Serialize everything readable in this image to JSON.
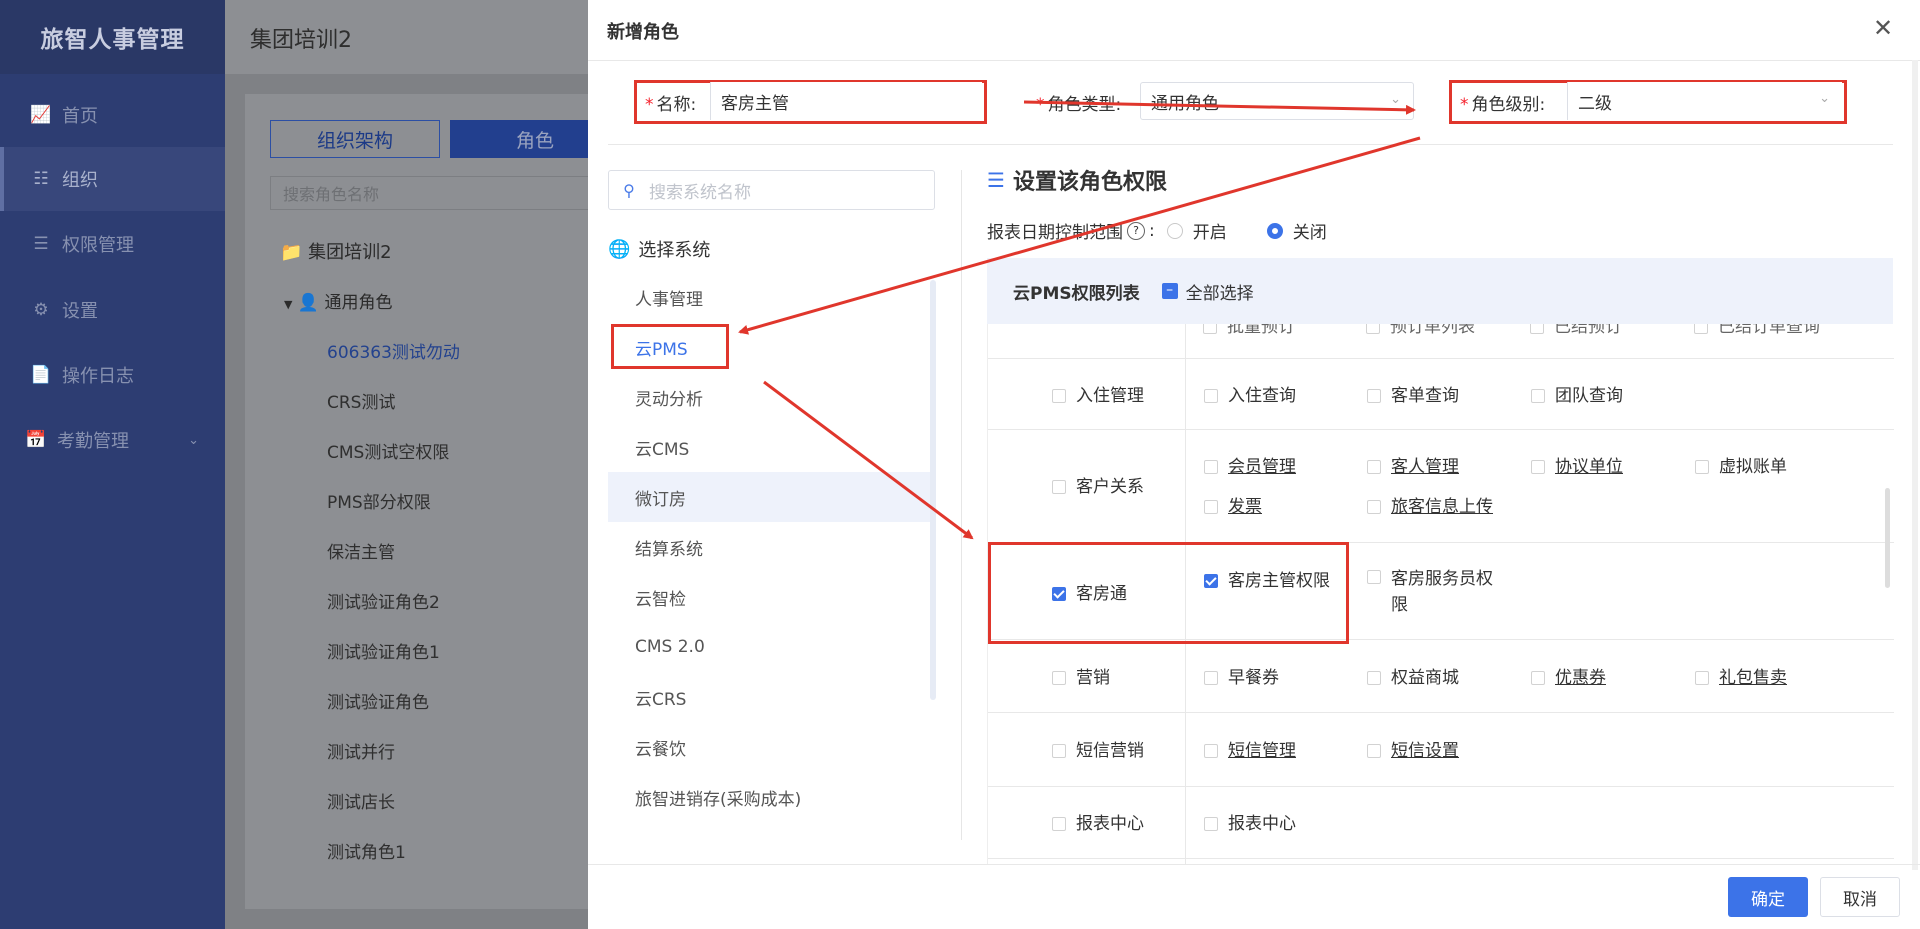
{
  "app": {
    "brand": "旅智人事管理",
    "nav": [
      {
        "label": "首页",
        "icon": "chart-icon"
      },
      {
        "label": "组织",
        "icon": "org-icon",
        "active": true
      },
      {
        "label": "权限管理",
        "icon": "sliders-icon"
      },
      {
        "label": "设置",
        "icon": "gear-icon"
      },
      {
        "label": "操作日志",
        "icon": "document-icon"
      },
      {
        "label": "考勤管理",
        "icon": "calendar-icon"
      }
    ]
  },
  "background": {
    "page_title": "集团培训2",
    "tabs": [
      "组织架构",
      "角色"
    ],
    "search_placeholder": "搜索角色名称",
    "tree_root": "集团培训2",
    "tree_group": "通用角色",
    "roles": [
      "606363测试勿动",
      "CRS测试",
      "CMS测试空权限",
      "PMS部分权限",
      "保洁主管",
      "测试验证角色2",
      "测试验证角色1",
      "测试验证角色",
      "测试并行",
      "测试店长",
      "测试角色1"
    ]
  },
  "modal": {
    "title": "新增角色",
    "name_label": "名称:",
    "name_value": "客房主管",
    "type_label": "角色类型:",
    "type_value": "通用角色",
    "level_label": "角色级别:",
    "level_value": "二级",
    "sys_search_placeholder": "搜索系统名称",
    "sys_head": "选择系统",
    "systems": [
      "人事管理",
      "云PMS",
      "灵动分析",
      "云CMS",
      "微订房",
      "结算系统",
      "云智检",
      "CMS 2.0",
      "云CRS",
      "云餐饮",
      "旅智进销存(采购成本)"
    ],
    "perm_title": "设置该角色权限",
    "date_ctrl_label": "报表日期控制范围",
    "radio_on": "开启",
    "radio_off": "关闭",
    "table_title": "云PMS权限列表",
    "select_all": "全部选择",
    "partial_row": [
      "批量预订",
      "预订单列表",
      "已结预订",
      "已结订单查询"
    ],
    "rows": [
      {
        "group": "入住管理",
        "items": [
          "入住查询",
          "客单查询",
          "团队查询"
        ]
      },
      {
        "group": "客户关系",
        "items": [
          "会员管理",
          "客人管理",
          "协议单位",
          "虚拟账单",
          "发票",
          "旅客信息上传"
        ]
      },
      {
        "group": "客房通",
        "items": [
          "客房主管权限",
          "客房服务员权限"
        ],
        "checked": true
      },
      {
        "group": "营销",
        "items": [
          "早餐券",
          "权益商城",
          "优惠券",
          "礼包售卖"
        ]
      },
      {
        "group": "短信营销",
        "items": [
          "短信管理",
          "短信设置"
        ]
      },
      {
        "group": "报表中心",
        "items": [
          "报表中心"
        ]
      }
    ],
    "ok": "确定",
    "cancel": "取消"
  },
  "colors": {
    "accent": "#3c73e8",
    "sidebar": "#2d3d72",
    "annotation_red": "#e0362c"
  }
}
